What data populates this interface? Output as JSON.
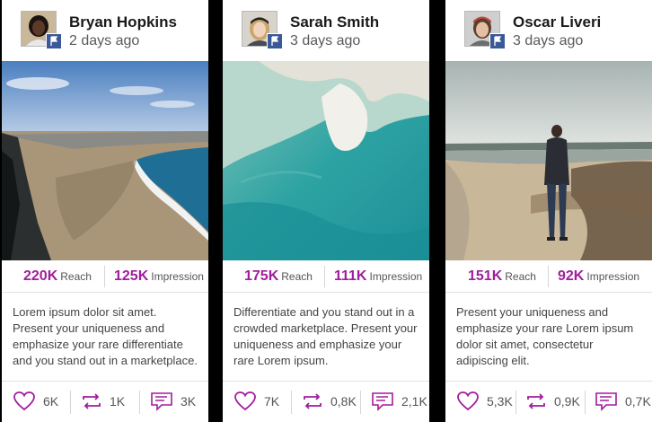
{
  "accent_color": "#a01d9d",
  "badge_color": "#3b5998",
  "cards": [
    {
      "name": "Bryan Hopkins",
      "time": "2 days ago",
      "badge_icon": "flag-icon",
      "reach": {
        "value": "220K",
        "label": "Reach"
      },
      "impression": {
        "value": "125K",
        "label": "Impression"
      },
      "description": "Lorem ipsum dolor sit amet. Present your uniqueness and emphasize your rare differentiate and you stand out in a marketplace.",
      "likes": "6K",
      "shares": "1K",
      "comments": "3K"
    },
    {
      "name": "Sarah Smith",
      "time": "3 days ago",
      "badge_icon": "flag-icon",
      "reach": {
        "value": "175K",
        "label": "Reach"
      },
      "impression": {
        "value": "111K",
        "label": "Impression"
      },
      "description": "Differentiate and you stand out in a crowded marketplace. Present your uniqueness and emphasize your rare Lorem ipsum.",
      "likes": "7K",
      "shares": "0,8K",
      "comments": "2,1K"
    },
    {
      "name": "Oscar Liveri",
      "time": "3 days ago",
      "badge_icon": "flag-icon",
      "reach": {
        "value": "151K",
        "label": "Reach"
      },
      "impression": {
        "value": "92K",
        "label": "Impression"
      },
      "description": "Present your uniqueness and emphasize your rare Lorem ipsum dolor sit amet, consectetur adipiscing elit.",
      "likes": "5,3K",
      "shares": "0,9K",
      "comments": "0,7K"
    }
  ]
}
